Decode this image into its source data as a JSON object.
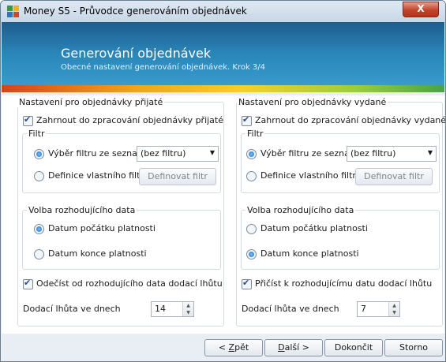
{
  "window": {
    "title": "Money S5 - Průvodce generováním objednávek",
    "close_symbol": "X"
  },
  "header": {
    "title": "Generování objednávek",
    "subtitle": "Obecné nastavení generování objednávek. Krok 3/4"
  },
  "left": {
    "group_label": "Nastavení pro objednávky přijaté",
    "include_label": "Zahrnout do zpracování objednávky přijaté",
    "include_checked": true,
    "filter_label": "Filtr",
    "filter_list_label": "Výběr filtru ze seznamu",
    "filter_list_value": "(bez filtru)",
    "filter_custom_label": "Definice vlastního filtru",
    "define_filter_button": "Definovat filtr",
    "filter_mode": "list",
    "date_group_label": "Volba rozhodujícího data",
    "date_start_label": "Datum počátku platnosti",
    "date_end_label": "Datum konce platnosti",
    "date_mode": "start",
    "offset_label": "Odečíst od rozhodujícího data dodací lhůtu",
    "offset_checked": true,
    "lead_time_label": "Dodací lhůta ve dnech",
    "lead_time_value": "14"
  },
  "right": {
    "group_label": "Nastavení pro objednávky vydané",
    "include_label": "Zahrnout do zpracování objednávky vydané",
    "include_checked": true,
    "filter_label": "Filtr",
    "filter_list_label": "Výběr filtru ze seznamu",
    "filter_list_value": "(bez filtru)",
    "filter_custom_label": "Definice vlastního filtru",
    "define_filter_button": "Definovat filtr",
    "filter_mode": "list",
    "date_group_label": "Volba rozhodujícího data",
    "date_start_label": "Datum počátku platnosti",
    "date_end_label": "Datum konce platnosti",
    "date_mode": "end",
    "offset_label": "Přičíst k rozhodujícímu datu dodací lhůtu",
    "offset_checked": true,
    "lead_time_label": "Dodací lhůta ve dnech",
    "lead_time_value": "7"
  },
  "footer": {
    "back_prefix": "< ",
    "back_key": "Z",
    "back_rest": "pět",
    "next_key": "D",
    "next_rest": "alší >",
    "finish_label": "Dokončit",
    "cancel_label": "Storno"
  },
  "icons": {
    "app": "money-s5-app-icon",
    "close": "close-icon",
    "dropdown": "chevron-down-icon",
    "spinner": "spinner-arrows-icon"
  }
}
